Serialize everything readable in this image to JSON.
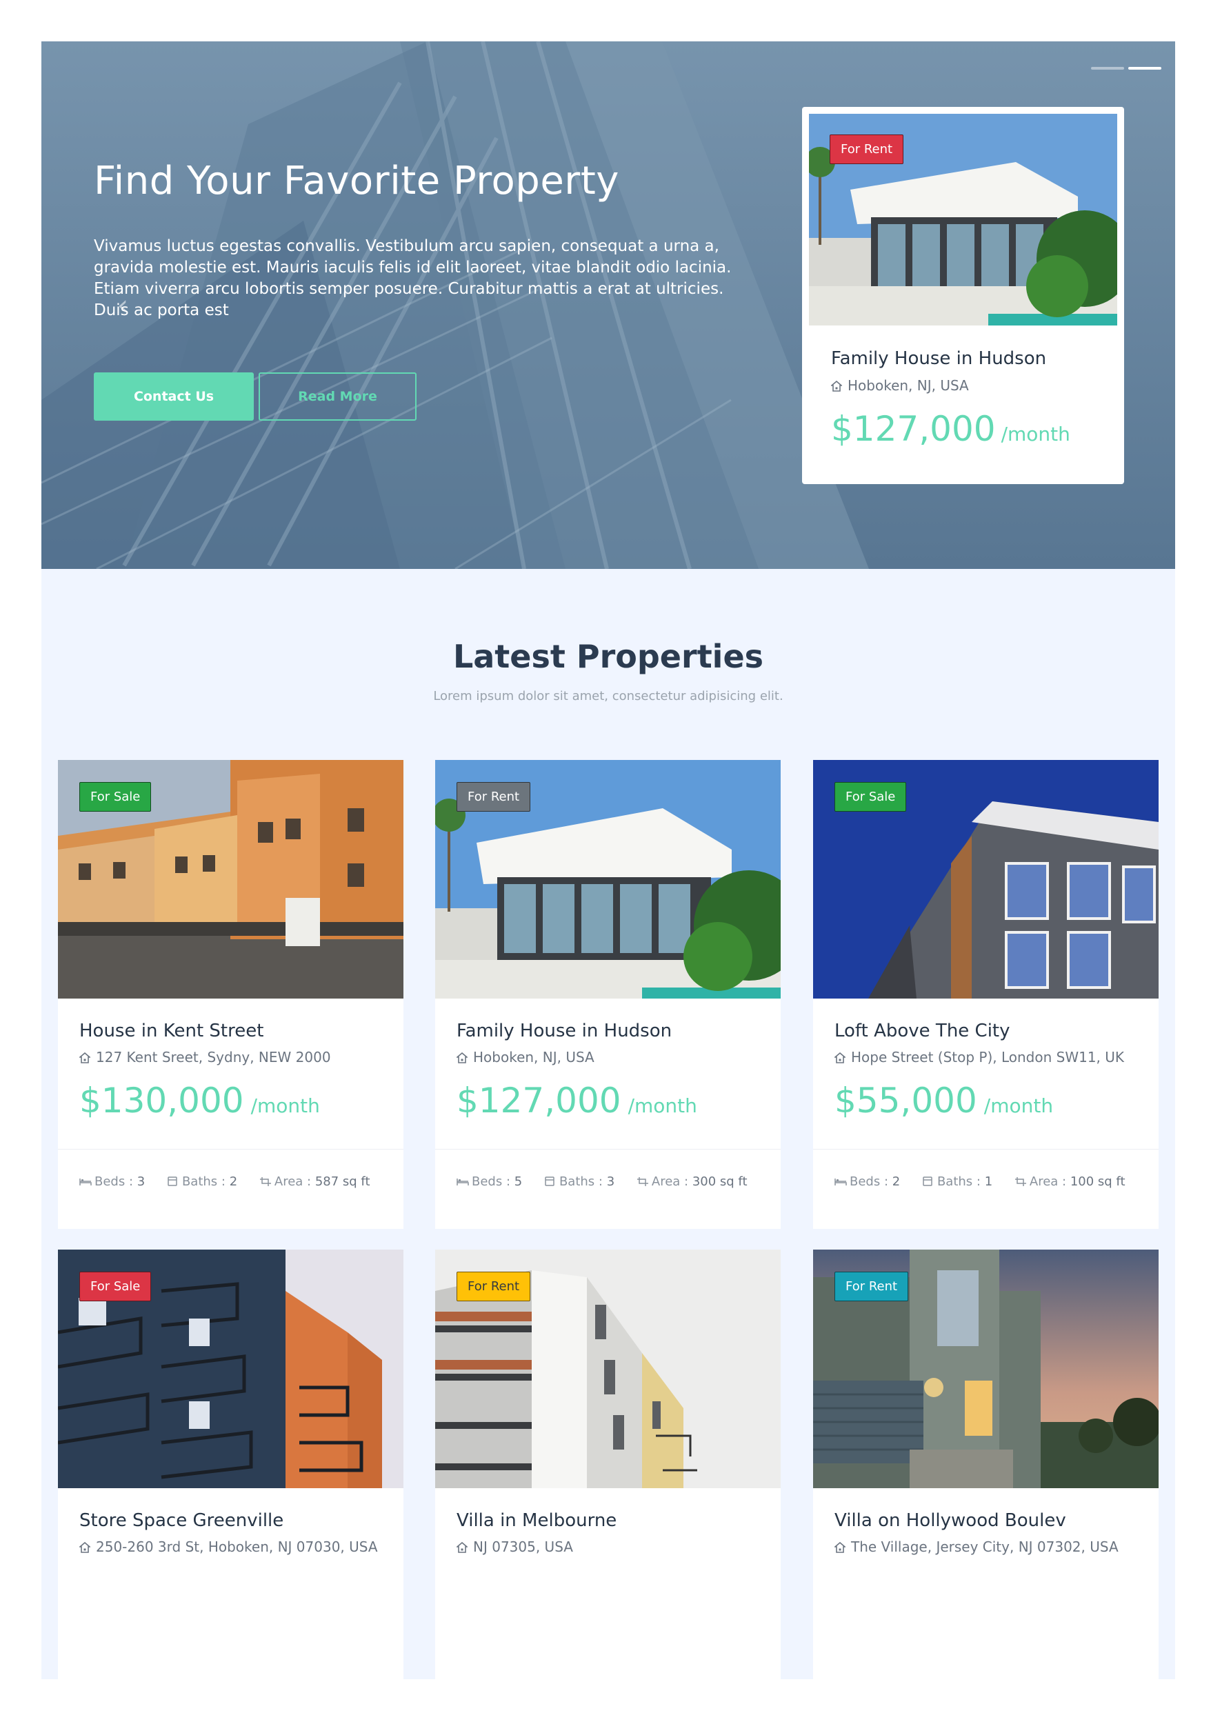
{
  "hero": {
    "title": "Find Your Favorite Property",
    "text": "Vivamus luctus egestas convallis. Vestibulum arcu sapien, consequat a urna a, gravida molestie est. Mauris iaculis felis id elit laoreet, vitae blandit odio lacinia. Etiam viverra arcu lobortis semper posuere. Curabitur mattis a erat at ultricies. Duis ac porta est",
    "contact_label": "Contact Us",
    "read_more_label": "Read More",
    "active_slide": 2,
    "slide_count": 2
  },
  "featured": {
    "badge": "For Rent",
    "title": "Family House in Hudson",
    "location": "Hoboken, NJ, USA",
    "price": "$127,000",
    "per": "/month"
  },
  "section": {
    "title": "Latest Properties",
    "subtitle": "Lorem ipsum dolor sit amet, consectetur adipisicing elit."
  },
  "colors": {
    "accent": "#62d9b3",
    "badge_for_sale_green": "#28a745",
    "badge_for_rent_gray": "#6c757d",
    "badge_red": "#dc3545",
    "badge_yellow": "#ffc107",
    "badge_teal": "#17a2b8"
  },
  "labels": {
    "beds": "Beds",
    "baths": "Baths",
    "area": "Area"
  },
  "properties": [
    {
      "badge": "For Sale",
      "title": "House in Kent Street",
      "location": "127 Kent Sreet, Sydny, NEW 2000",
      "price": "$130,000",
      "per": "/month",
      "beds": "3",
      "baths": "2",
      "area": "587 sq ft"
    },
    {
      "badge": "For Rent",
      "title": "Family House in Hudson",
      "location": "Hoboken, NJ, USA",
      "price": "$127,000",
      "per": "/month",
      "beds": "5",
      "baths": "3",
      "area": "300 sq ft"
    },
    {
      "badge": "For Sale",
      "title": "Loft Above The City",
      "location": "Hope Street (Stop P), London SW11, UK",
      "price": "$55,000",
      "per": "/month",
      "beds": "2",
      "baths": "1",
      "area": "100 sq ft"
    },
    {
      "badge": "For Sale",
      "title": "Store Space Greenville",
      "location": "250-260 3rd St, Hoboken, NJ 07030, USA"
    },
    {
      "badge": "For Rent",
      "title": "Villa in Melbourne",
      "location": "NJ 07305, USA"
    },
    {
      "badge": "For Rent",
      "title": "Villa on Hollywood Boulev",
      "location": "The Village, Jersey City, NJ 07302, USA"
    }
  ]
}
